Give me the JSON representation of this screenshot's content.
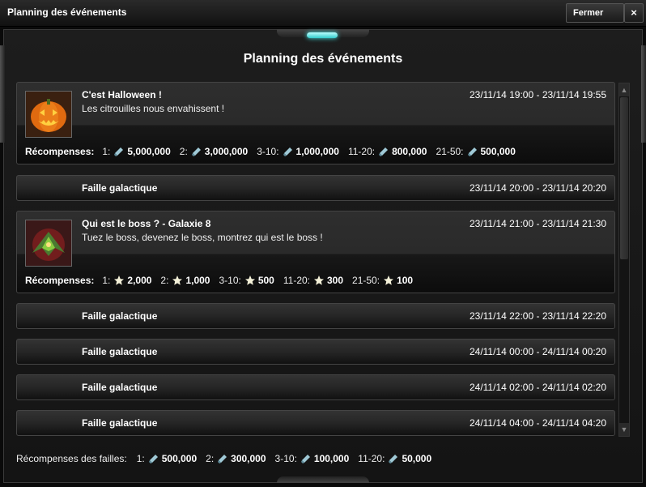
{
  "window": {
    "title": "Planning des événements",
    "close_label": "Fermer",
    "close_x": "×"
  },
  "heading": "Planning des événements",
  "events": [
    {
      "name": "C'est Halloween !",
      "date": "23/11/14 19:00 - 23/11/14 19:55",
      "description": "Les citrouilles nous envahissent !",
      "rewards_label": "Récompenses:",
      "reward_icon": "crystal-icon",
      "rewards": [
        {
          "rank": "1:",
          "amount": "5,000,000"
        },
        {
          "rank": "2:",
          "amount": "3,000,000"
        },
        {
          "rank": "3-10:",
          "amount": "1,000,000"
        },
        {
          "rank": "11-20:",
          "amount": "800,000"
        },
        {
          "rank": "21-50:",
          "amount": "500,000"
        }
      ]
    },
    {
      "name": "Faille galactique",
      "date": "23/11/14 20:00 - 23/11/14 20:20"
    },
    {
      "name": "Qui est le boss ?  -  Galaxie 8",
      "date": "23/11/14 21:00 - 23/11/14 21:30",
      "description": "Tuez le boss, devenez le boss, montrez qui est le boss !",
      "rewards_label": "Récompenses:",
      "reward_icon": "star-icon",
      "rewards": [
        {
          "rank": "1:",
          "amount": "2,000"
        },
        {
          "rank": "2:",
          "amount": "1,000"
        },
        {
          "rank": "3-10:",
          "amount": "500"
        },
        {
          "rank": "11-20:",
          "amount": "300"
        },
        {
          "rank": "21-50:",
          "amount": "100"
        }
      ]
    },
    {
      "name": "Faille galactique",
      "date": "23/11/14 22:00 - 23/11/14 22:20"
    },
    {
      "name": "Faille galactique",
      "date": "24/11/14 00:00 - 24/11/14 00:20"
    },
    {
      "name": "Faille galactique",
      "date": "24/11/14 02:00 - 24/11/14 02:20"
    },
    {
      "name": "Faille galactique",
      "date": "24/11/14 04:00 - 24/11/14 04:20"
    }
  ],
  "footer": {
    "label": "Récompenses des failles:",
    "reward_icon": "crystal-icon",
    "rewards": [
      {
        "rank": "1:",
        "amount": "500,000"
      },
      {
        "rank": "2:",
        "amount": "300,000"
      },
      {
        "rank": "3-10:",
        "amount": "100,000"
      },
      {
        "rank": "11-20:",
        "amount": "50,000"
      }
    ]
  },
  "scrollbar": {
    "up": "▲",
    "down": "▼"
  },
  "colors": {
    "accent_glow": "#44eeee",
    "crystal": "#9fc9d6",
    "star": "#f3f0d8"
  }
}
